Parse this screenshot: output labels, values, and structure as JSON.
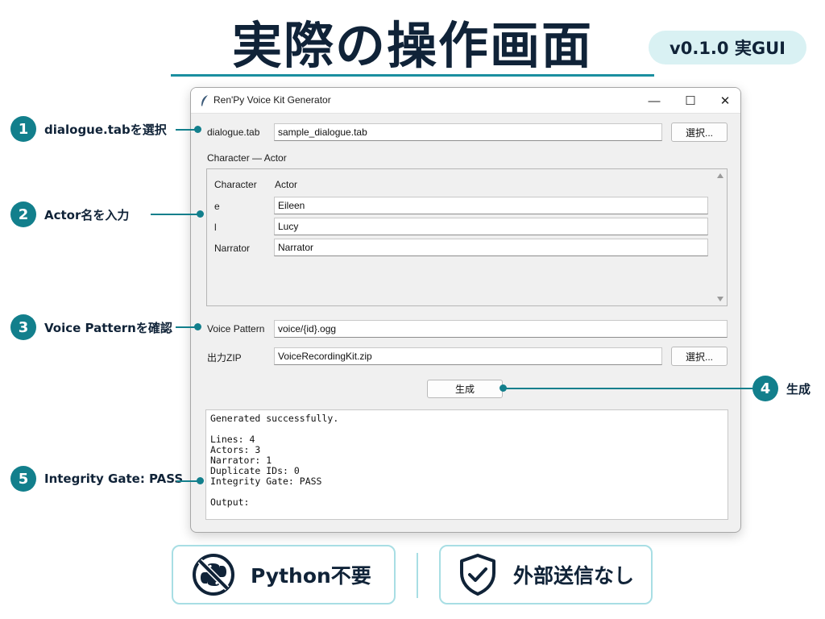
{
  "header": {
    "title": "実際の操作画面",
    "version_badge": "v0.1.0 実GUI"
  },
  "window": {
    "title": "Ren'Py Voice Kit Generator",
    "controls": {
      "minimize": "—",
      "maximize": "☐",
      "close": "✕"
    },
    "dialogue_label": "dialogue.tab",
    "dialogue_value": "sample_dialogue.tab",
    "select_button": "選択...",
    "section_label": "Character — Actor",
    "table": {
      "col_character": "Character",
      "col_actor": "Actor",
      "rows": [
        {
          "character": "e",
          "actor": "Eileen"
        },
        {
          "character": "l",
          "actor": "Lucy"
        },
        {
          "character": "Narrator",
          "actor": "Narrator"
        }
      ]
    },
    "voice_pattern_label": "Voice Pattern",
    "voice_pattern_value": "voice/{id}.ogg",
    "output_zip_label": "出力ZIP",
    "output_zip_value": "VoiceRecordingKit.zip",
    "output_select_button": "選択...",
    "generate_button": "生成",
    "output_text": "Generated successfully.\n\nLines: 4\nActors: 3\nNarrator: 1\nDuplicate IDs: 0\nIntegrity Gate: PASS\n\nOutput:"
  },
  "callouts": [
    {
      "num": "1",
      "text": "dialogue.tabを選択"
    },
    {
      "num": "2",
      "text": "Actor名を入力"
    },
    {
      "num": "3",
      "text": "Voice Patternを確認"
    },
    {
      "num": "4",
      "text": "生成"
    },
    {
      "num": "5",
      "text": "Integrity Gate: PASS"
    }
  ],
  "badges": {
    "python_free": "Python不要",
    "no_external_send": "外部送信なし"
  },
  "colors": {
    "accent": "#127f8c",
    "navy": "#102338",
    "pill_bg": "#d9f1f3",
    "badge_border": "#a8dee4"
  },
  "icons": {
    "app": "feather-icon",
    "python_free": "no-python-icon",
    "security": "shield-check-icon"
  }
}
